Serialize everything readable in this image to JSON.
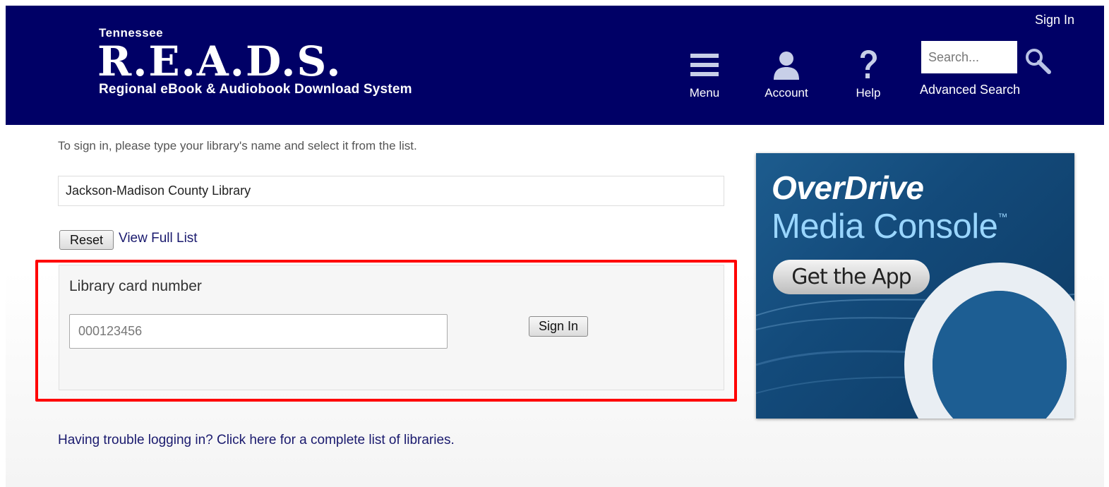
{
  "header": {
    "logo": {
      "state": "Tennessee",
      "name": "R.E.A.D.S.",
      "subtitle": "Regional eBook & Audiobook Download System"
    },
    "nav": [
      {
        "label": "Menu",
        "icon": "menu-icon"
      },
      {
        "label": "Account",
        "icon": "account-icon"
      },
      {
        "label": "Help",
        "icon": "help-icon"
      }
    ],
    "sign_in": "Sign In",
    "search": {
      "placeholder": "Search...",
      "icon": "search-icon"
    },
    "advanced_search": "Advanced Search"
  },
  "signin_form": {
    "instruction": "To sign in, please type your library's name and select it from the list.",
    "library_value": "Jackson-Madison County Library",
    "reset_label": "Reset",
    "view_full_list": "View Full List",
    "card_label": "Library card number",
    "card_placeholder": "000123456",
    "sign_in_button": "Sign In",
    "trouble_link": "Having trouble logging in? Click here for a complete list of libraries."
  },
  "ad": {
    "brand": "OverDrive",
    "product": "Media Console",
    "trademark": "™",
    "cta": "Get the App"
  },
  "colors": {
    "header_bg": "#000066",
    "link": "#1a1a6e",
    "highlight": "#ff0000"
  }
}
